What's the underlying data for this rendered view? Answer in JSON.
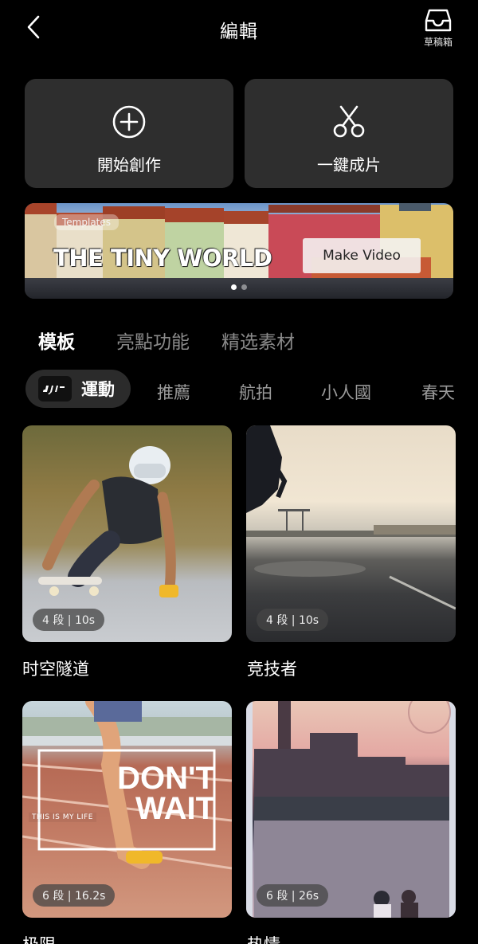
{
  "header": {
    "title": "編輯",
    "drafts_label": "草稿箱"
  },
  "actions": [
    {
      "label": "開始創作",
      "icon": "plus-circle-icon"
    },
    {
      "label": "一鍵成片",
      "icon": "scissors-icon"
    }
  ],
  "banner": {
    "tag": "Templates",
    "headline": "THE TINY WORLD",
    "button": "Make Video",
    "pages": 2,
    "active_page": 1
  },
  "tabs": [
    {
      "label": "模板",
      "active": true
    },
    {
      "label": "亮點功能",
      "active": false
    },
    {
      "label": "精选素材",
      "active": false
    }
  ],
  "chips": [
    {
      "label": "運動",
      "active": true,
      "icon": "dji-logo-icon"
    },
    {
      "label": "推薦",
      "active": false
    },
    {
      "label": "航拍",
      "active": false
    },
    {
      "label": "小人國",
      "active": false
    },
    {
      "label": "春天",
      "active": false
    }
  ],
  "templates": [
    {
      "title": "时空隧道",
      "badge": "4 段 | 10s"
    },
    {
      "title": "竞技者",
      "badge": "4 段 | 10s"
    },
    {
      "title": "极限",
      "badge": "6 段 | 16.2s",
      "overlay_big": "DON'T\nWAIT",
      "overlay_small": "THIS IS MY LIFE"
    },
    {
      "title": "热情",
      "badge": "6 段 | 26s"
    }
  ],
  "colors": {
    "background": "#000000",
    "tile": "#2e2e2e",
    "chip_active": "#2b2b2b",
    "inactive_text": "#8a8a8a"
  }
}
